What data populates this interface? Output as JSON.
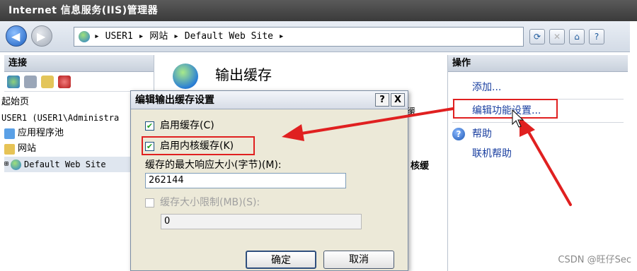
{
  "window": {
    "title": "Internet 信息服务(IIS)管理器"
  },
  "toolbar": {
    "address_path": "▸ USER1 ▸ 网站 ▸ Default Web Site ▸",
    "icons": [
      "refresh-icon",
      "stop-icon",
      "home-icon",
      "help-icon"
    ]
  },
  "connections": {
    "header": "连接",
    "tree": [
      {
        "label": "起始页",
        "icon": "start-page-icon"
      },
      {
        "label": "USER1 (USER1\\Administra",
        "icon": "server-icon"
      },
      {
        "label": "应用程序池",
        "icon": "app-pool-icon"
      },
      {
        "label": "网站",
        "icon": "sites-folder-icon"
      },
      {
        "label": "Default Web Site",
        "icon": "globe-icon"
      }
    ]
  },
  "main": {
    "title": "输出缓存",
    "frag_top": "缓",
    "frag_col": "核缓"
  },
  "actions": {
    "header": "操作",
    "items": [
      "添加...",
      "编辑功能设置...",
      "帮助",
      "联机帮助"
    ]
  },
  "dialog": {
    "title": "编辑输出缓存设置",
    "help_button": "?",
    "close_button": "X",
    "enable_cache_label": "启用缓存(C)",
    "enable_cache_checked": true,
    "enable_kernel_label": "启用内核缓存(K)",
    "enable_kernel_checked": true,
    "max_response_label": "缓存的最大响应大小(字节)(M):",
    "max_response_value": "262144",
    "size_limit_label": "缓存大小限制(MB)(S):",
    "size_limit_checked": false,
    "size_limit_value": "0",
    "ok_label": "确定",
    "cancel_label": "取消"
  },
  "watermark": "CSDN @旺仔Sec"
}
